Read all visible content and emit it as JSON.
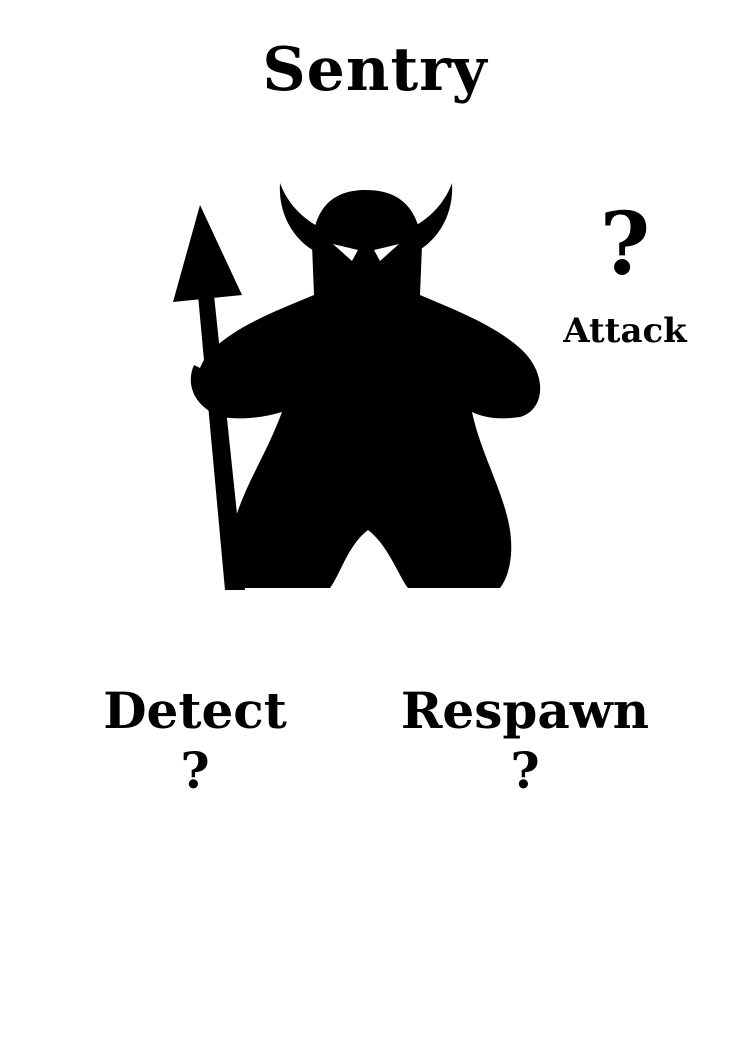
{
  "card": {
    "title": "Sentry",
    "stats": {
      "attack": {
        "label": "Attack",
        "value": "?"
      },
      "detect": {
        "label": "Detect",
        "value": "?"
      },
      "respawn": {
        "label": "Respawn",
        "value": "?"
      }
    },
    "figure": {
      "icon": "horned-meeple-with-spear-icon",
      "fill_color": "#000000",
      "eye_color": "#ffffff"
    },
    "background_color": "#ffffff"
  }
}
